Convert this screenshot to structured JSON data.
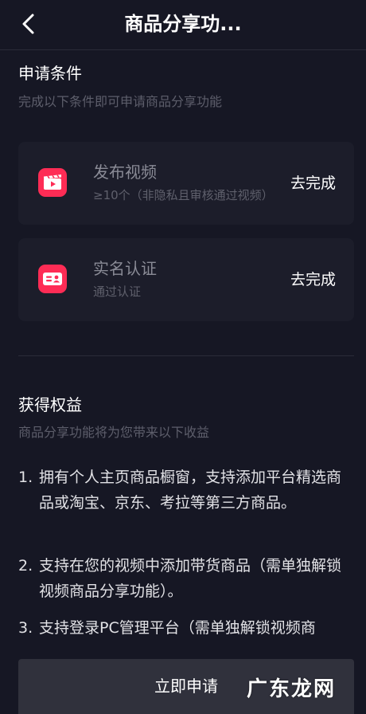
{
  "header": {
    "title": "商品分享功..."
  },
  "conditions": {
    "heading": "申请条件",
    "subheading": "完成以下条件即可申请商品分享功能",
    "items": [
      {
        "icon": "video-clapper-icon",
        "title": "发布视频",
        "desc": "≥10个（非隐私且审核通过视频）",
        "action": "去完成"
      },
      {
        "icon": "id-card-icon",
        "title": "实名认证",
        "desc": "通过认证",
        "action": "去完成"
      }
    ]
  },
  "benefits": {
    "heading": "获得权益",
    "subheading": "商品分享功能将为您带来以下收益",
    "items": [
      {
        "num": "1.",
        "text": "拥有个人主页商品橱窗，支持添加平台精选商品或淘宝、京东、考拉等第三方商品。"
      },
      {
        "num": "2.",
        "text": "支持在您的视频中添加带货商品（需单独解锁视频商品分享功能）。"
      },
      {
        "num": "3.",
        "text": "支持登录PC管理平台（需单独解锁视频商"
      }
    ]
  },
  "apply_button": {
    "label": "立即申请"
  },
  "watermark": "广东龙网",
  "colors": {
    "background": "#161724",
    "card": "#1c1d2a",
    "accent": "#fe2c55",
    "button": "#30313c"
  }
}
